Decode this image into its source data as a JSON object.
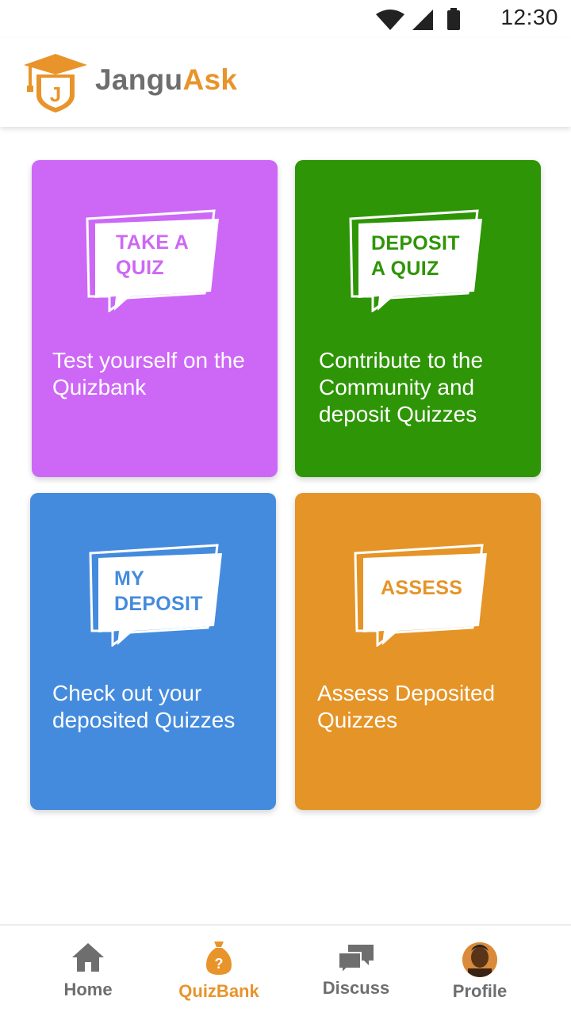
{
  "status_bar": {
    "time": "12:30"
  },
  "header": {
    "brand_part1": "Jangu",
    "brand_part2": "Ask"
  },
  "colors": {
    "brand_orange": "#e8942a",
    "take_quiz": "#cd68f6",
    "deposit_quiz": "#2e9506",
    "my_deposit": "#448bdd",
    "assess": "#e59427"
  },
  "cards": [
    {
      "bubble_line1": "TAKE A",
      "bubble_line2": "QUIZ",
      "description": "Test yourself on the Quizbank"
    },
    {
      "bubble_line1": "DEPOSIT",
      "bubble_line2": "A QUIZ",
      "description": "Contribute to the Community and deposit Quizzes"
    },
    {
      "bubble_line1": "MY",
      "bubble_line2": "DEPOSIT",
      "description": "Check out your deposited Quizzes"
    },
    {
      "bubble_line1": "ASSESS",
      "bubble_line2": "",
      "description": "Assess Deposited Quizzes"
    }
  ],
  "nav": [
    {
      "label": "Home",
      "icon": "home-icon"
    },
    {
      "label": "QuizBank",
      "icon": "moneybag-question-icon",
      "active": true
    },
    {
      "label": "Discuss",
      "icon": "chat-bubbles-icon"
    },
    {
      "label": "Profile",
      "icon": "avatar"
    }
  ]
}
